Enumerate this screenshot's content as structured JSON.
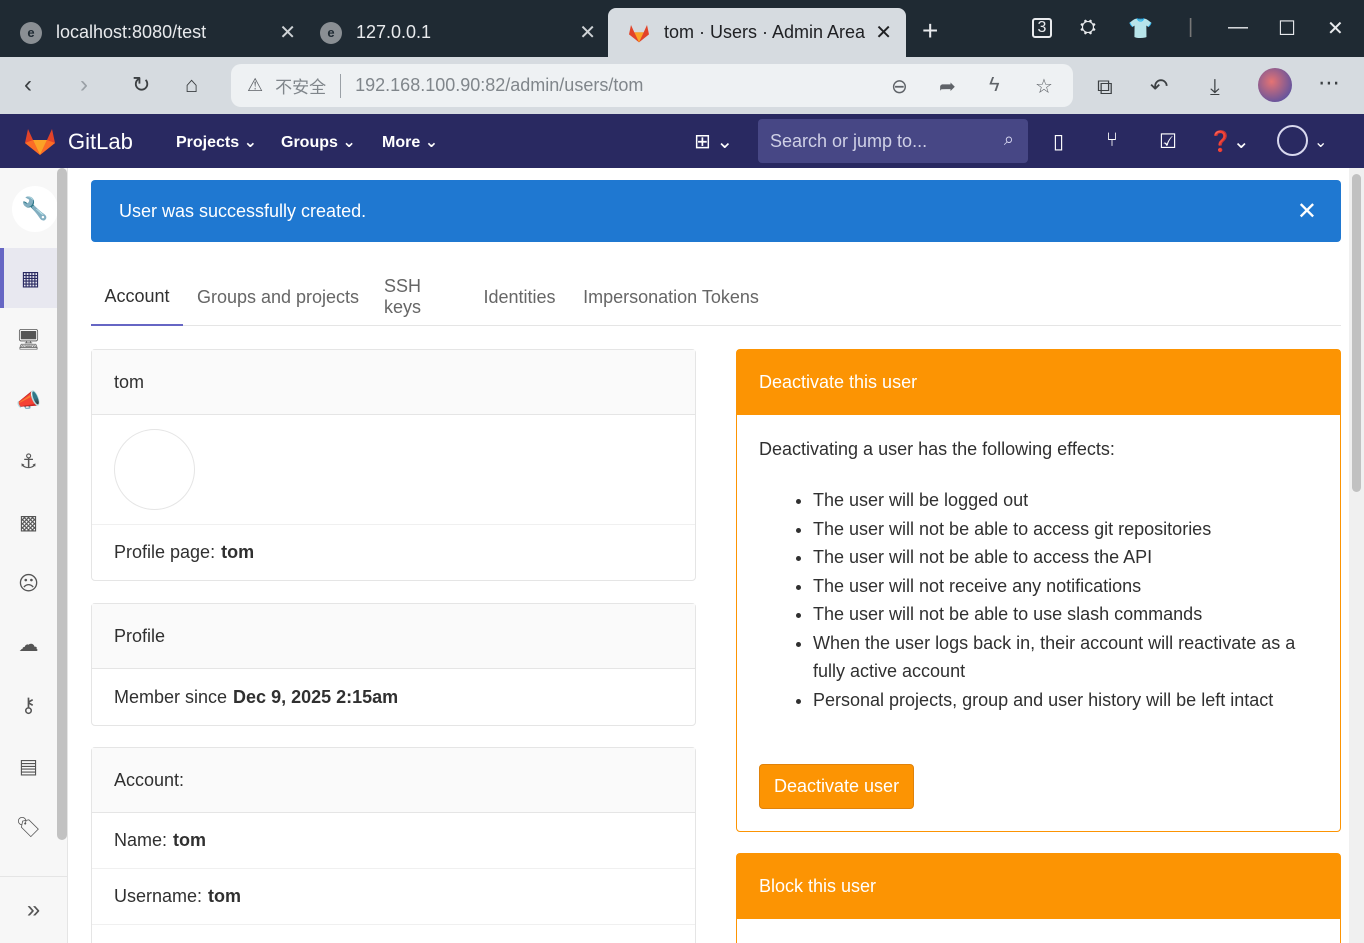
{
  "browser": {
    "tabs": [
      {
        "title": "localhost:8080/test",
        "icon": "globe-icon"
      },
      {
        "title": "127.0.0.1",
        "icon": "globe-icon"
      },
      {
        "title": "tom · Users · Admin Area",
        "icon": "gitlab-icon",
        "active": true
      }
    ],
    "address": {
      "security_label": "不安全",
      "url": "192.168.100.90:82/admin/users/tom"
    }
  },
  "gitlab": {
    "brand": "GitLab",
    "nav": {
      "projects": "Projects",
      "groups": "Groups",
      "more": "More"
    },
    "search_placeholder": "Search or jump to..."
  },
  "flash": {
    "message": "User was successfully created."
  },
  "tabs": [
    {
      "label": "Account",
      "active": true
    },
    {
      "label": "Groups and projects"
    },
    {
      "label": "SSH keys"
    },
    {
      "label": "Identities"
    },
    {
      "label": "Impersonation Tokens"
    }
  ],
  "user_card": {
    "name": "tom",
    "profile_page_label": "Profile page:",
    "profile_page_value": "tom"
  },
  "profile_card": {
    "title": "Profile",
    "member_since_label": "Member since",
    "member_since_value": "Dec 9, 2025 2:15am"
  },
  "account_card": {
    "title": "Account:",
    "name_label": "Name:",
    "name_value": "tom",
    "username_label": "Username:",
    "username_value": "tom"
  },
  "deactivate_card": {
    "title": "Deactivate this user",
    "intro": "Deactivating a user has the following effects:",
    "effects": [
      "The user will be logged out",
      "The user will not be able to access git repositories",
      "The user will not be able to access the API",
      "The user will not receive any notifications",
      "The user will not be able to use slash commands",
      "When the user logs back in, their account will reactivate as a fully active account",
      "Personal projects, group and user history will be left intact"
    ],
    "button": "Deactivate user"
  },
  "block_card": {
    "title": "Block this user"
  },
  "colors": {
    "header_bg": "#292961",
    "flash_bg": "#1f78d1",
    "warning": "#fc9403",
    "active_tab_underline": "#6666c4"
  }
}
